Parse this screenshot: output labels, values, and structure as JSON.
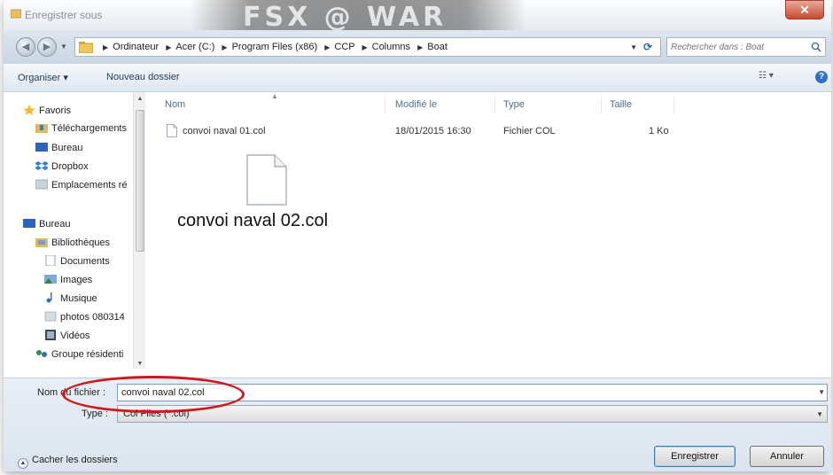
{
  "window": {
    "title": "Enregistrer sous",
    "close_label": "✕",
    "banner_text": "FSX @ WAR"
  },
  "address": {
    "crumbs": [
      "Ordinateur",
      "Acer (C:)",
      "Program Files (x86)",
      "CCP",
      "Columns",
      "Boat"
    ],
    "search_placeholder": "Rechercher dans : Boat"
  },
  "toolbar": {
    "organiser": "Organiser ▾",
    "new_folder": "Nouveau dossier",
    "views": "☷ ▾",
    "help": "?"
  },
  "nav": {
    "items": [
      {
        "label": "Favoris",
        "icon": "star-icon"
      },
      {
        "label": "Téléchargements",
        "icon": "downloads-folder-icon"
      },
      {
        "label": "Bureau",
        "icon": "desktop-icon"
      },
      {
        "label": "Dropbox",
        "icon": "dropbox-icon"
      },
      {
        "label": "Emplacements ré",
        "icon": "recent-places-icon"
      },
      {
        "label": "Bureau",
        "icon": "desktop-icon"
      },
      {
        "label": "Bibliothèques",
        "icon": "libraries-icon"
      },
      {
        "label": "Documents",
        "icon": "documents-icon"
      },
      {
        "label": "Images",
        "icon": "images-icon"
      },
      {
        "label": "Musique",
        "icon": "music-icon"
      },
      {
        "label": "photos 080314",
        "icon": "photos-icon"
      },
      {
        "label": "Vidéos",
        "icon": "videos-icon"
      },
      {
        "label": "Groupe résidenti",
        "icon": "homegroup-icon"
      }
    ]
  },
  "columns": {
    "name": "Nom",
    "modified": "Modifié le",
    "type": "Type",
    "size": "Taille"
  },
  "files": [
    {
      "name": "convoi naval 01.col",
      "modified": "18/01/2015 16:30",
      "type": "Fichier COL",
      "size": "1 Ko"
    }
  ],
  "drag_preview": {
    "label": "convoi naval 02.col"
  },
  "form": {
    "name_label": "Nom du fichier :",
    "name_value": "convoi naval 02.col",
    "type_label": "Type :",
    "type_value": "Col Files (*.col)"
  },
  "footer": {
    "hide_folders": "Cacher les dossiers",
    "save": "Enregistrer",
    "cancel": "Annuler"
  },
  "colors": {
    "highlight": "#d0161b",
    "accent": "#2f73c4"
  }
}
